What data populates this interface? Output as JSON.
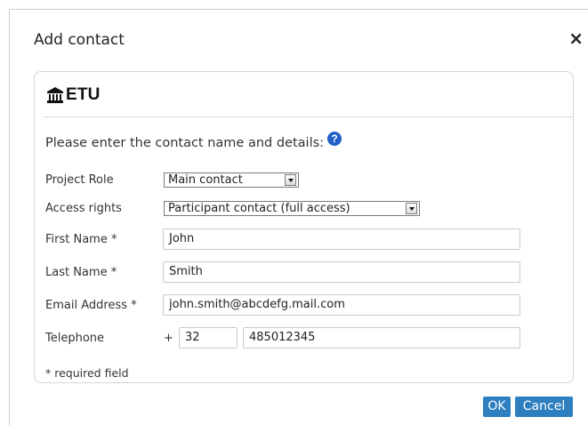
{
  "dialog": {
    "title": "Add contact",
    "close_glyph": "×"
  },
  "brand": {
    "icon": "bank-building-icon",
    "name": "ETU"
  },
  "form": {
    "intro": "Please enter the contact name and details:",
    "help_glyph": "?",
    "project_role": {
      "label": "Project Role",
      "value": "Main contact"
    },
    "access_rights": {
      "label": "Access rights",
      "value": "Participant contact (full access)"
    },
    "first_name": {
      "label": "First Name *",
      "value": "John"
    },
    "last_name": {
      "label": "Last Name *",
      "value": "Smith"
    },
    "email": {
      "label": "Email Address *",
      "value": "john.smith@abcdefg.mail.com"
    },
    "telephone": {
      "label": "Telephone",
      "plus": "+",
      "country_code": "32",
      "number": "485012345"
    },
    "required_note": "* required field"
  },
  "buttons": {
    "ok": "OK",
    "cancel": "Cancel"
  },
  "colors": {
    "button_bg": "#2e7fc0",
    "help_bg": "#1f5fc7"
  }
}
